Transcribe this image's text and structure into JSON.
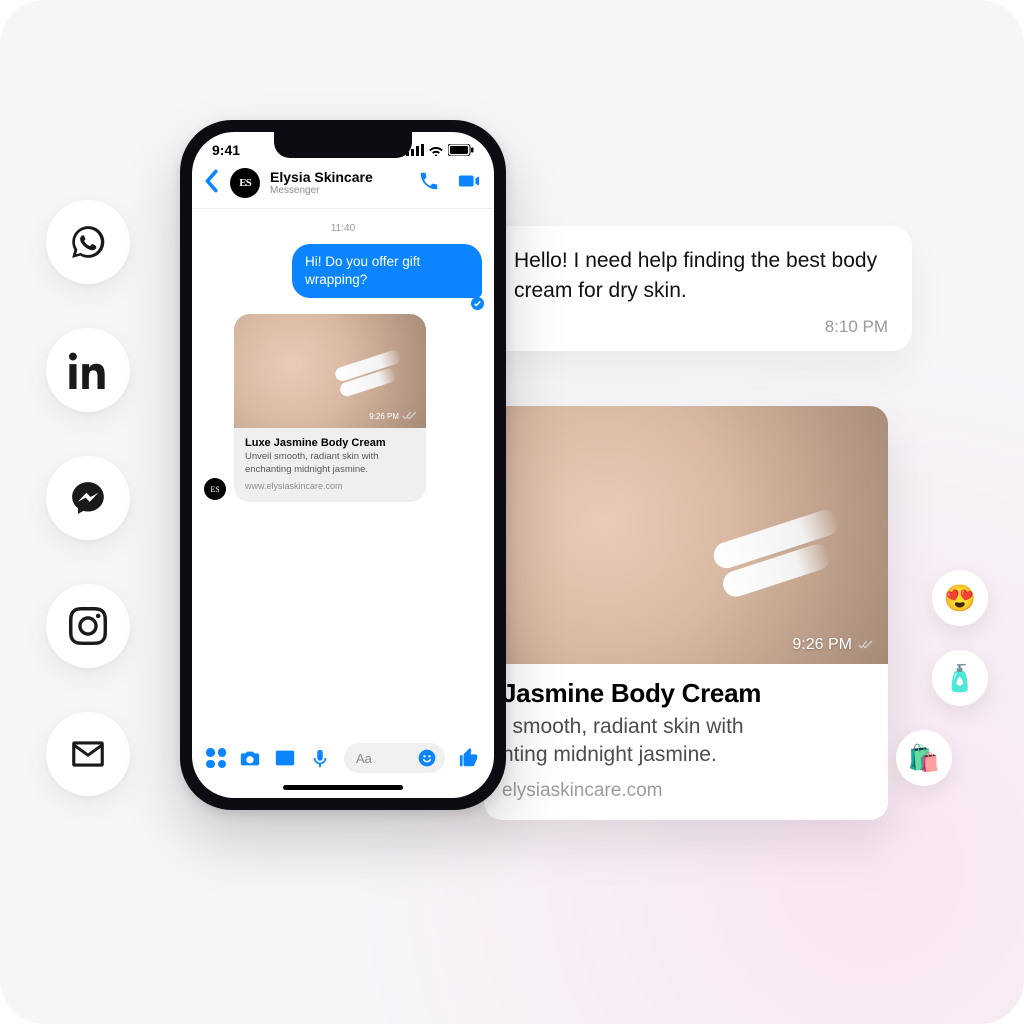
{
  "phone": {
    "status_time": "9:41",
    "header": {
      "avatar_initials": "ES",
      "name": "Elysia Skincare",
      "subtitle": "Messenger"
    },
    "thread_timestamp": "11:40",
    "outgoing_message": "Hi! Do you offer gift wrapping?",
    "card": {
      "timestamp": "9:26 PM",
      "title": "Luxe Jasmine Body Cream",
      "description": "Unveil smooth, radiant skin with enchanting midnight jasmine.",
      "url": "www.elysiaskincare.com"
    },
    "composer_placeholder": "Aa"
  },
  "floating_bubble": {
    "text": "Hello! I need help finding the best body cream for dry skin.",
    "timestamp": "8:10 PM"
  },
  "floating_card": {
    "timestamp": "9:26 PM",
    "title": "Jasmine Body Cream",
    "line1": "l smooth, radiant skin with",
    "line2": "nting midnight jasmine.",
    "url": "elysiaskincare.com"
  },
  "channels": [
    "whatsapp",
    "linkedin",
    "messenger",
    "instagram",
    "mail"
  ],
  "product_emojis": [
    "😍",
    "🧴",
    "🛍️"
  ]
}
